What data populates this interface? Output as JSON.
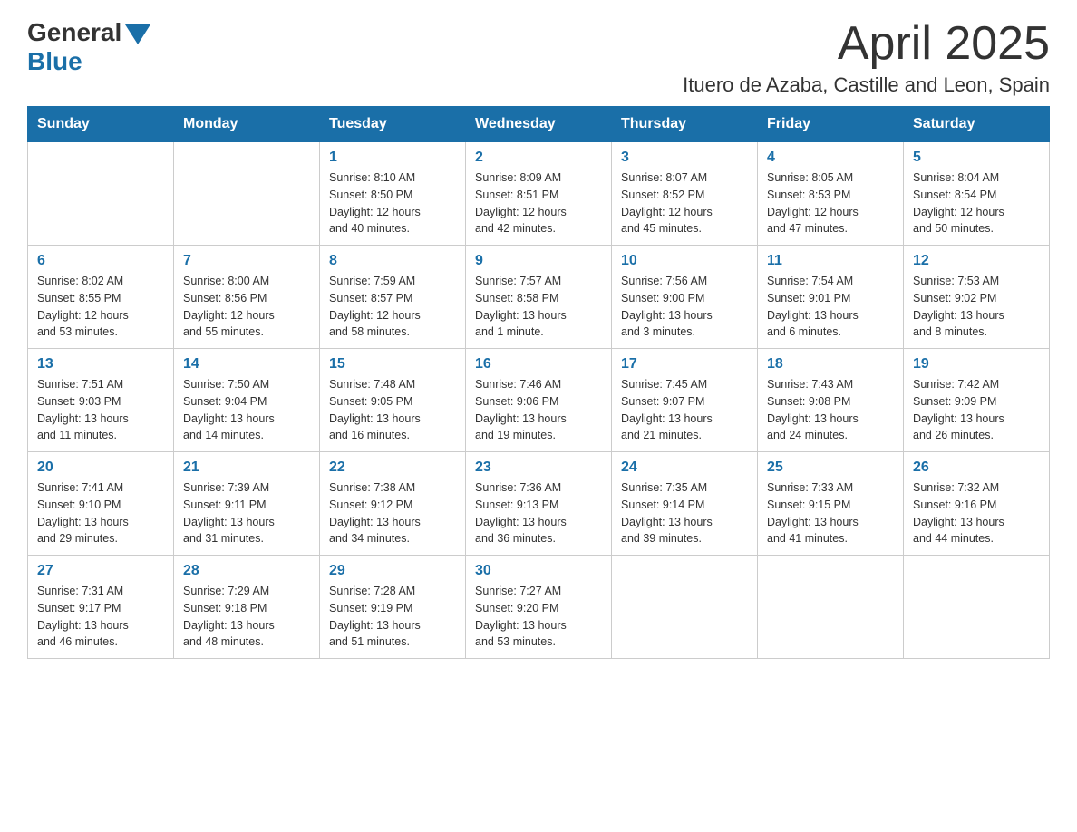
{
  "header": {
    "logo_general": "General",
    "logo_blue": "Blue",
    "month_title": "April 2025",
    "location": "Ituero de Azaba, Castille and Leon, Spain"
  },
  "weekdays": [
    "Sunday",
    "Monday",
    "Tuesday",
    "Wednesday",
    "Thursday",
    "Friday",
    "Saturday"
  ],
  "weeks": [
    [
      {
        "day": "",
        "info": ""
      },
      {
        "day": "",
        "info": ""
      },
      {
        "day": "1",
        "info": "Sunrise: 8:10 AM\nSunset: 8:50 PM\nDaylight: 12 hours\nand 40 minutes."
      },
      {
        "day": "2",
        "info": "Sunrise: 8:09 AM\nSunset: 8:51 PM\nDaylight: 12 hours\nand 42 minutes."
      },
      {
        "day": "3",
        "info": "Sunrise: 8:07 AM\nSunset: 8:52 PM\nDaylight: 12 hours\nand 45 minutes."
      },
      {
        "day": "4",
        "info": "Sunrise: 8:05 AM\nSunset: 8:53 PM\nDaylight: 12 hours\nand 47 minutes."
      },
      {
        "day": "5",
        "info": "Sunrise: 8:04 AM\nSunset: 8:54 PM\nDaylight: 12 hours\nand 50 minutes."
      }
    ],
    [
      {
        "day": "6",
        "info": "Sunrise: 8:02 AM\nSunset: 8:55 PM\nDaylight: 12 hours\nand 53 minutes."
      },
      {
        "day": "7",
        "info": "Sunrise: 8:00 AM\nSunset: 8:56 PM\nDaylight: 12 hours\nand 55 minutes."
      },
      {
        "day": "8",
        "info": "Sunrise: 7:59 AM\nSunset: 8:57 PM\nDaylight: 12 hours\nand 58 minutes."
      },
      {
        "day": "9",
        "info": "Sunrise: 7:57 AM\nSunset: 8:58 PM\nDaylight: 13 hours\nand 1 minute."
      },
      {
        "day": "10",
        "info": "Sunrise: 7:56 AM\nSunset: 9:00 PM\nDaylight: 13 hours\nand 3 minutes."
      },
      {
        "day": "11",
        "info": "Sunrise: 7:54 AM\nSunset: 9:01 PM\nDaylight: 13 hours\nand 6 minutes."
      },
      {
        "day": "12",
        "info": "Sunrise: 7:53 AM\nSunset: 9:02 PM\nDaylight: 13 hours\nand 8 minutes."
      }
    ],
    [
      {
        "day": "13",
        "info": "Sunrise: 7:51 AM\nSunset: 9:03 PM\nDaylight: 13 hours\nand 11 minutes."
      },
      {
        "day": "14",
        "info": "Sunrise: 7:50 AM\nSunset: 9:04 PM\nDaylight: 13 hours\nand 14 minutes."
      },
      {
        "day": "15",
        "info": "Sunrise: 7:48 AM\nSunset: 9:05 PM\nDaylight: 13 hours\nand 16 minutes."
      },
      {
        "day": "16",
        "info": "Sunrise: 7:46 AM\nSunset: 9:06 PM\nDaylight: 13 hours\nand 19 minutes."
      },
      {
        "day": "17",
        "info": "Sunrise: 7:45 AM\nSunset: 9:07 PM\nDaylight: 13 hours\nand 21 minutes."
      },
      {
        "day": "18",
        "info": "Sunrise: 7:43 AM\nSunset: 9:08 PM\nDaylight: 13 hours\nand 24 minutes."
      },
      {
        "day": "19",
        "info": "Sunrise: 7:42 AM\nSunset: 9:09 PM\nDaylight: 13 hours\nand 26 minutes."
      }
    ],
    [
      {
        "day": "20",
        "info": "Sunrise: 7:41 AM\nSunset: 9:10 PM\nDaylight: 13 hours\nand 29 minutes."
      },
      {
        "day": "21",
        "info": "Sunrise: 7:39 AM\nSunset: 9:11 PM\nDaylight: 13 hours\nand 31 minutes."
      },
      {
        "day": "22",
        "info": "Sunrise: 7:38 AM\nSunset: 9:12 PM\nDaylight: 13 hours\nand 34 minutes."
      },
      {
        "day": "23",
        "info": "Sunrise: 7:36 AM\nSunset: 9:13 PM\nDaylight: 13 hours\nand 36 minutes."
      },
      {
        "day": "24",
        "info": "Sunrise: 7:35 AM\nSunset: 9:14 PM\nDaylight: 13 hours\nand 39 minutes."
      },
      {
        "day": "25",
        "info": "Sunrise: 7:33 AM\nSunset: 9:15 PM\nDaylight: 13 hours\nand 41 minutes."
      },
      {
        "day": "26",
        "info": "Sunrise: 7:32 AM\nSunset: 9:16 PM\nDaylight: 13 hours\nand 44 minutes."
      }
    ],
    [
      {
        "day": "27",
        "info": "Sunrise: 7:31 AM\nSunset: 9:17 PM\nDaylight: 13 hours\nand 46 minutes."
      },
      {
        "day": "28",
        "info": "Sunrise: 7:29 AM\nSunset: 9:18 PM\nDaylight: 13 hours\nand 48 minutes."
      },
      {
        "day": "29",
        "info": "Sunrise: 7:28 AM\nSunset: 9:19 PM\nDaylight: 13 hours\nand 51 minutes."
      },
      {
        "day": "30",
        "info": "Sunrise: 7:27 AM\nSunset: 9:20 PM\nDaylight: 13 hours\nand 53 minutes."
      },
      {
        "day": "",
        "info": ""
      },
      {
        "day": "",
        "info": ""
      },
      {
        "day": "",
        "info": ""
      }
    ]
  ]
}
